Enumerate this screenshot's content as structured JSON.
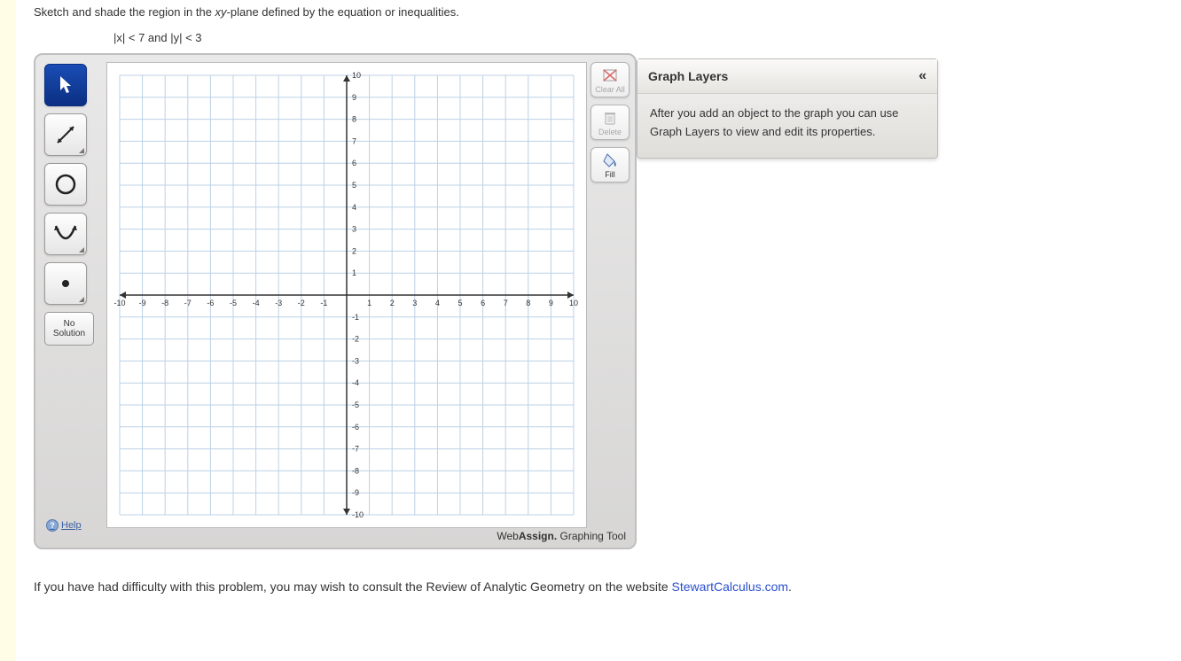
{
  "instruction": "Sketch and shade the region in the ",
  "instruction_plane": "xy",
  "instruction_suffix": "-plane defined by the equation or inequalities.",
  "inequality_text": "|x| < 7 and |y| < 3",
  "tools": {
    "pointer": "pointer",
    "line": "line",
    "circle": "circle",
    "parabola": "parabola",
    "point": "point",
    "no_solution_line1": "No",
    "no_solution_line2": "Solution"
  },
  "help_label": "Help",
  "right_buttons": {
    "clear_all": "Clear All",
    "delete": "Delete",
    "fill": "Fill"
  },
  "footer_brand_bold1": "Web",
  "footer_brand_bold2": "Assign.",
  "footer_brand_rest": " Graphing Tool",
  "layers": {
    "title": "Graph Layers",
    "body": "After you add an object to the graph you can use Graph Layers to view and edit its properties."
  },
  "hint_prefix": "If you have had difficulty with this problem, you may wish to consult the Review of Analytic Geometry on the website ",
  "hint_link": "StewartCalculus.com",
  "hint_suffix": ".",
  "chart_data": {
    "type": "scatter",
    "title": "",
    "xlabel": "",
    "ylabel": "",
    "xlim": [
      -10,
      10
    ],
    "ylim": [
      -10,
      10
    ],
    "x_ticks": [
      -10,
      -9,
      -8,
      -7,
      -6,
      -5,
      -4,
      -3,
      -2,
      -1,
      1,
      2,
      3,
      4,
      5,
      6,
      7,
      8,
      9,
      10
    ],
    "y_ticks": [
      -10,
      -9,
      -8,
      -7,
      -6,
      -5,
      -4,
      -3,
      -2,
      -1,
      1,
      2,
      3,
      4,
      5,
      6,
      7,
      8,
      9,
      10
    ],
    "series": [],
    "grid": true
  }
}
